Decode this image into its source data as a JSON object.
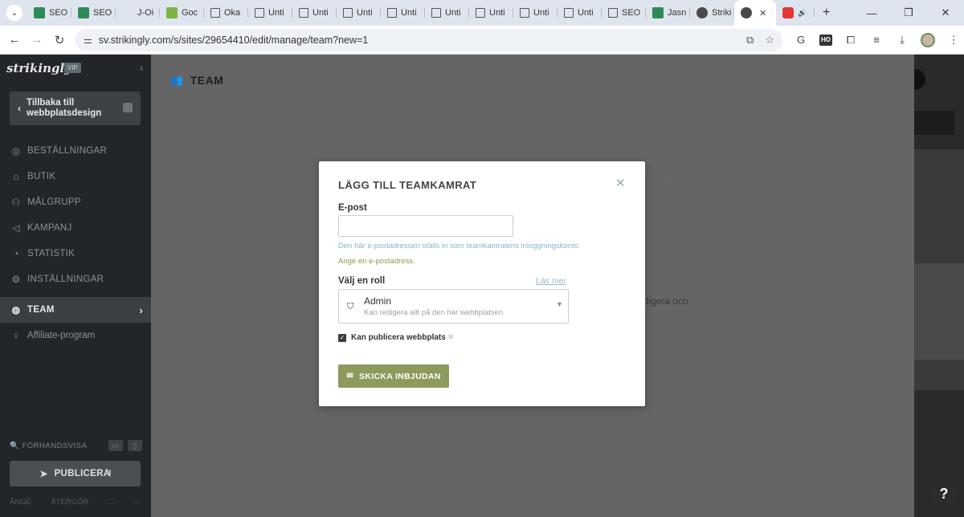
{
  "browser": {
    "tabs": [
      {
        "title": "SEO",
        "icon": "green"
      },
      {
        "title": "SEO",
        "icon": "green"
      },
      {
        "title": "J-Oi",
        "icon": "drive"
      },
      {
        "title": "Goc",
        "icon": "goc"
      },
      {
        "title": "Oka",
        "icon": "doc"
      },
      {
        "title": "Unti",
        "icon": "doc"
      },
      {
        "title": "Unti",
        "icon": "doc"
      },
      {
        "title": "Unti",
        "icon": "doc"
      },
      {
        "title": "Unti",
        "icon": "doc"
      },
      {
        "title": "Unti",
        "icon": "doc"
      },
      {
        "title": "Unti",
        "icon": "doc"
      },
      {
        "title": "Unti",
        "icon": "doc"
      },
      {
        "title": "Unti",
        "icon": "doc"
      },
      {
        "title": "SEO",
        "icon": "doc"
      },
      {
        "title": "Jasn",
        "icon": "green"
      },
      {
        "title": "Striki",
        "icon": "blue"
      }
    ],
    "active_tab": {
      "title": "",
      "close": "✕"
    },
    "extra_tab": {
      "title": "",
      "audio": "🔊"
    },
    "new_tab": "+",
    "window_controls": {
      "minimize": "—",
      "restore": "❐",
      "close": "✕"
    },
    "url": "sv.strikingly.com/s/sites/29654410/edit/manage/team?new=1"
  },
  "sidebar": {
    "logo": "strikingly",
    "vip": "VIP",
    "collapse": "‹",
    "back_label": "Tillbaka till webbplatsdesign",
    "nav": [
      {
        "icon": "◎",
        "label": "BESTÄLLNINGAR",
        "name": "orders"
      },
      {
        "icon": "⌂",
        "label": "BUTIK",
        "name": "store"
      },
      {
        "icon": "⚇",
        "label": "MÅLGRUPP",
        "name": "audience"
      },
      {
        "icon": "◁",
        "label": "KAMPANJ",
        "name": "campaign"
      },
      {
        "icon": "◔",
        "label": "STATISTIK",
        "name": "statistics"
      },
      {
        "icon": "⚙",
        "label": "INSTÄLLNINGAR",
        "name": "settings"
      }
    ],
    "active_item": {
      "icon": "◍",
      "label": "TEAM",
      "arrow": "›"
    },
    "affiliate": {
      "icon": "♀",
      "label": "Affiliate-program"
    },
    "preview_label": "FÖRHANDSVISA",
    "publish_label": "PUBLICERA",
    "publish_badge": "!",
    "footer": [
      "ÅNGE",
      "ÅTERGÖR",
      "...",
      "⋯"
    ]
  },
  "main": {
    "title": "TEAM",
    "bg_text_1": ". . .",
    "bg_text_2": "redigera och"
  },
  "modal": {
    "title": "LÄGG TILL TEAMKAMRAT",
    "close": "✕",
    "email_label": "E-post",
    "email_value": "",
    "email_help": "Den här e-postadressen ställs in som teamkamratens inloggningskonto",
    "email_hint": "Ange en e-postadress.",
    "role_label": "Välj en roll",
    "read_more": "Läs mer",
    "role_name": "Admin",
    "role_desc": "Kan redigera allt på den här webbplatsen",
    "can_publish_label": "Kan publicera webbplats",
    "can_publish_checked": true,
    "send_button": "SKICKA INBJUDAN"
  },
  "help_button": "?",
  "colors": {
    "accent_green": "#8c9a5c",
    "sidebar_bg": "#232629",
    "overlay": "#656565"
  }
}
